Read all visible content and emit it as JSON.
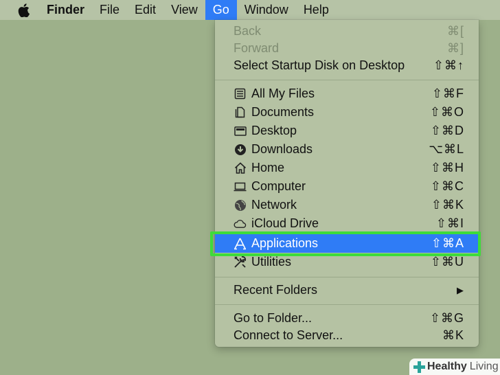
{
  "menubar": {
    "apple": "",
    "items": [
      "Finder",
      "File",
      "Edit",
      "View",
      "Go",
      "Window",
      "Help"
    ]
  },
  "go_menu": {
    "back": {
      "label": "Back",
      "shortcut": "⌘["
    },
    "forward": {
      "label": "Forward",
      "shortcut": "⌘]"
    },
    "startup": {
      "label": "Select Startup Disk on Desktop",
      "shortcut": "⇧⌘↑"
    },
    "places": [
      {
        "label": "All My Files",
        "shortcut": "⇧⌘F",
        "icon": "all-files-icon"
      },
      {
        "label": "Documents",
        "shortcut": "⇧⌘O",
        "icon": "documents-icon"
      },
      {
        "label": "Desktop",
        "shortcut": "⇧⌘D",
        "icon": "desktop-icon"
      },
      {
        "label": "Downloads",
        "shortcut": "⌥⌘L",
        "icon": "downloads-icon"
      },
      {
        "label": "Home",
        "shortcut": "⇧⌘H",
        "icon": "home-icon"
      },
      {
        "label": "Computer",
        "shortcut": "⇧⌘C",
        "icon": "computer-icon"
      },
      {
        "label": "Network",
        "shortcut": "⇧⌘K",
        "icon": "network-icon"
      },
      {
        "label": "iCloud Drive",
        "shortcut": "⇧⌘I",
        "icon": "icloud-icon"
      },
      {
        "label": "Applications",
        "shortcut": "⇧⌘A",
        "icon": "applications-icon"
      },
      {
        "label": "Utilities",
        "shortcut": "⇧⌘U",
        "icon": "utilities-icon"
      }
    ],
    "recent": {
      "label": "Recent Folders",
      "submenu_arrow": "▶"
    },
    "goto": {
      "label": "Go to Folder...",
      "shortcut": "⇧⌘G"
    },
    "connect": {
      "label": "Connect to Server...",
      "shortcut": "⌘K"
    }
  },
  "watermark": {
    "brand1": "Healthy",
    "brand2": "Living"
  },
  "colors": {
    "accent": "#2f7cf6",
    "highlight_frame": "#3ddc3a",
    "desktop": "#9db08a"
  }
}
